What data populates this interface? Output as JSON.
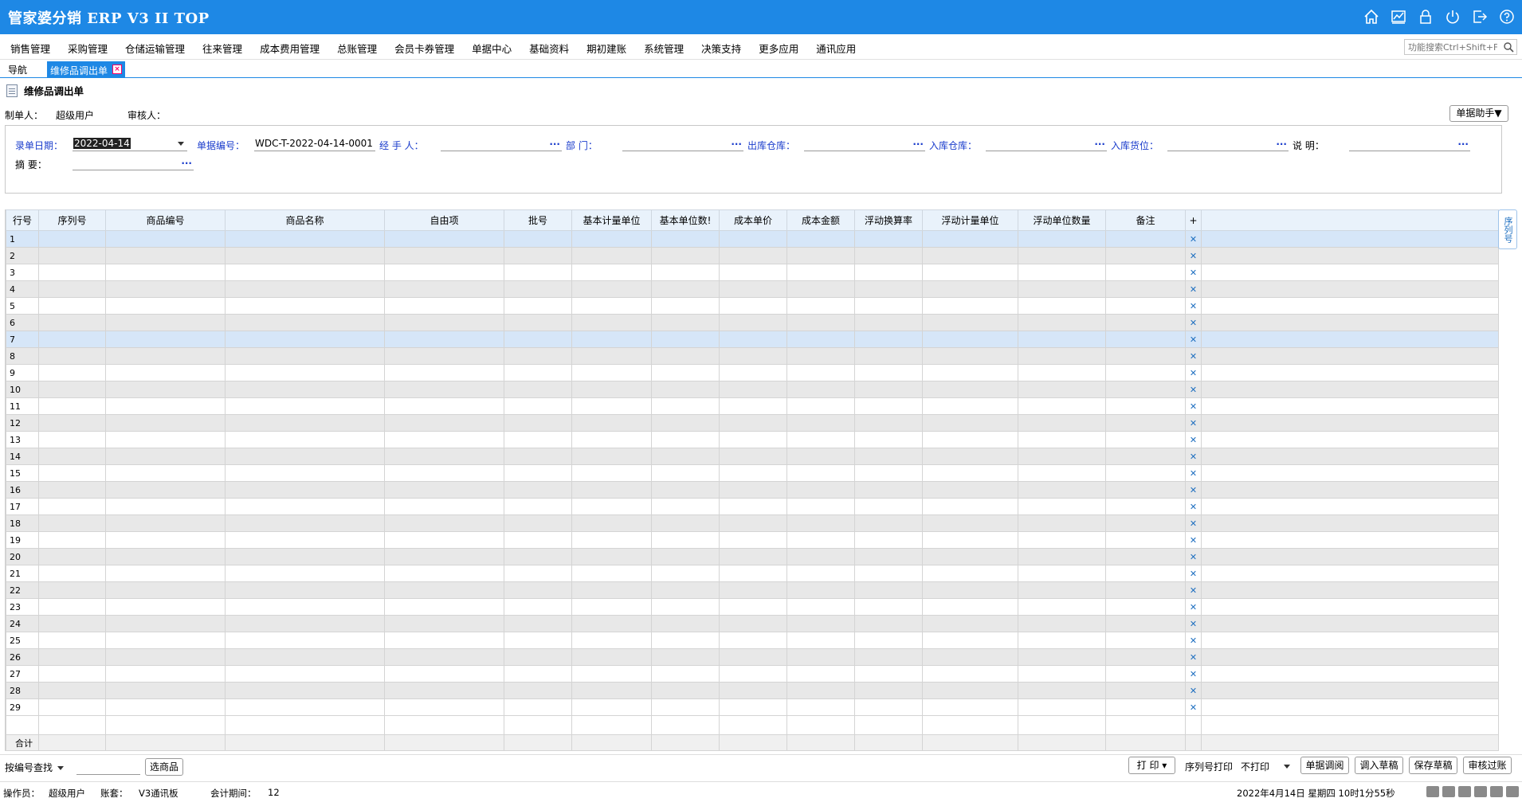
{
  "app": {
    "title": "管家婆分销 ERP V3 II TOP"
  },
  "titlebar_icons": [
    "home-icon",
    "chart-icon",
    "lock-icon",
    "power-icon",
    "exit-icon",
    "help-icon"
  ],
  "menu": {
    "items": [
      "销售管理",
      "采购管理",
      "仓储运输管理",
      "往来管理",
      "成本费用管理",
      "总账管理",
      "会员卡券管理",
      "单据中心",
      "基础资料",
      "期初建账",
      "系统管理",
      "决策支持",
      "更多应用",
      "通讯应用"
    ],
    "search_placeholder": "功能搜索Ctrl+Shift+F"
  },
  "tabs": {
    "nav": "导航",
    "active": "维修品调出单"
  },
  "doc": {
    "title": "维修品调出单",
    "maker_label": "制单人：",
    "maker_value": "超级用户",
    "auditor_label": "审核人：",
    "auditor_value": "",
    "helper_button": "单据助手▼"
  },
  "form": {
    "date_label": "录单日期：",
    "date_value": "2022-04-14",
    "number_label": "单据编号：",
    "number_value": "WDC-T-2022-04-14-0001",
    "handler_label": "经  手  人：",
    "dept_label": "部        门：",
    "out_wh_label": "出库仓库：",
    "in_wh_label": "入库仓库：",
    "in_loc_label": "入库货位：",
    "note_label": "说        明：",
    "summary_label": "摘        要：",
    "dots": "···"
  },
  "grid": {
    "headers": [
      "行号",
      "序列号",
      "商品编号",
      "商品名称",
      "自由项",
      "批号",
      "基本计量单位",
      "基本单位数!",
      "成本单价",
      "成本金额",
      "浮动换算率",
      "浮动计量单位",
      "浮动单位数量",
      "备注",
      "+",
      ""
    ],
    "rows": [
      "1",
      "2",
      "3",
      "4",
      "5",
      "6",
      "7",
      "8",
      "9",
      "10",
      "11",
      "12",
      "13",
      "14",
      "15",
      "16",
      "17",
      "18",
      "19",
      "20",
      "21",
      "22",
      "23",
      "24",
      "25",
      "26",
      "27",
      "28",
      "29"
    ],
    "total_label": "合计",
    "delete_glyph": "✕"
  },
  "side_tab": "序列号",
  "bottom": {
    "find_label": "按编号查找",
    "select_goods": "选商品",
    "print": "打 印 ▾",
    "serial_print_label": "序列号打印",
    "serial_print_value": "不打印",
    "btn_call": "单据调阅",
    "btn_load_draft": "调入草稿",
    "btn_save_draft": "保存草稿",
    "btn_audit": "审核过账"
  },
  "status": {
    "operator_label": "操作员：",
    "operator_value": "超级用户",
    "account_label": "账套：",
    "account_value": "V3通讯板",
    "period_label": "会计期间：",
    "period_value": "12",
    "datetime": "2022年4月14日  星期四  10时1分55秒"
  },
  "colors": {
    "accent": "#1e88e5",
    "link_label": "#1a3ccc",
    "row_highlight": "#d6e6f8",
    "row_alt": "#e8e8e8"
  }
}
